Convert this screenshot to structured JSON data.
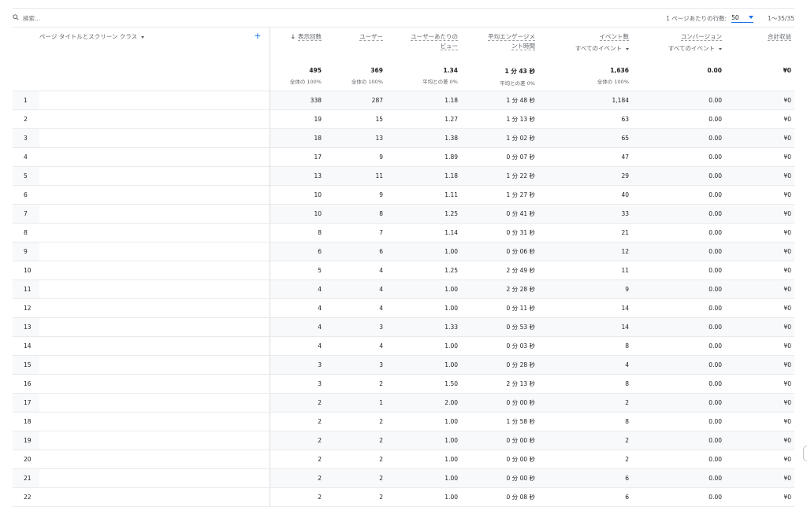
{
  "search": {
    "placeholder": "検索..."
  },
  "pagination": {
    "rows_per_page_label": "1 ページあたりの行数:",
    "rows_per_page": "50",
    "range": "1〜35/35"
  },
  "dimension_header": "ページ タイトルとスクリーン クラス",
  "columns": [
    {
      "label": "表示回数",
      "sub": ""
    },
    {
      "label": "ユーザー",
      "sub": ""
    },
    {
      "label": "ユーザーあたりの",
      "label2": "ビュー",
      "sub": ""
    },
    {
      "label": "平均エンゲージメ",
      "label2": "ント時間",
      "sub": ""
    },
    {
      "label": "イベント数",
      "sub": "すべてのイベント"
    },
    {
      "label": "コンバージョン",
      "sub": "すべてのイベント"
    },
    {
      "label": "合計収益",
      "sub": ""
    }
  ],
  "totals": {
    "views": "495",
    "views_pct": "全体の 100%",
    "users": "369",
    "users_pct": "全体の 100%",
    "vpu": "1.34",
    "vpu_diff": "平均との差 0%",
    "eng": "1 分 43 秒",
    "eng_diff": "平均との差 0%",
    "events": "1,636",
    "events_pct": "全体の 100%",
    "conv": "0.00",
    "rev": "¥0"
  },
  "rows": [
    [
      "1",
      "338",
      "287",
      "1.18",
      "1 分 48 秒",
      "1,184",
      "0.00",
      "¥0"
    ],
    [
      "2",
      "19",
      "15",
      "1.27",
      "1 分 13 秒",
      "63",
      "0.00",
      "¥0"
    ],
    [
      "3",
      "18",
      "13",
      "1.38",
      "1 分 02 秒",
      "65",
      "0.00",
      "¥0"
    ],
    [
      "4",
      "17",
      "9",
      "1.89",
      "0 分 07 秒",
      "47",
      "0.00",
      "¥0"
    ],
    [
      "5",
      "13",
      "11",
      "1.18",
      "1 分 22 秒",
      "29",
      "0.00",
      "¥0"
    ],
    [
      "6",
      "10",
      "9",
      "1.11",
      "1 分 27 秒",
      "40",
      "0.00",
      "¥0"
    ],
    [
      "7",
      "10",
      "8",
      "1.25",
      "0 分 41 秒",
      "33",
      "0.00",
      "¥0"
    ],
    [
      "8",
      "8",
      "7",
      "1.14",
      "0 分 31 秒",
      "21",
      "0.00",
      "¥0"
    ],
    [
      "9",
      "6",
      "6",
      "1.00",
      "0 分 06 秒",
      "12",
      "0.00",
      "¥0"
    ],
    [
      "10",
      "5",
      "4",
      "1.25",
      "2 分 49 秒",
      "11",
      "0.00",
      "¥0"
    ],
    [
      "11",
      "4",
      "4",
      "1.00",
      "2 分 28 秒",
      "9",
      "0.00",
      "¥0"
    ],
    [
      "12",
      "4",
      "4",
      "1.00",
      "0 分 11 秒",
      "14",
      "0.00",
      "¥0"
    ],
    [
      "13",
      "4",
      "3",
      "1.33",
      "0 分 53 秒",
      "14",
      "0.00",
      "¥0"
    ],
    [
      "14",
      "4",
      "4",
      "1.00",
      "0 分 03 秒",
      "8",
      "0.00",
      "¥0"
    ],
    [
      "15",
      "3",
      "3",
      "1.00",
      "0 分 28 秒",
      "4",
      "0.00",
      "¥0"
    ],
    [
      "16",
      "3",
      "2",
      "1.50",
      "2 分 13 秒",
      "8",
      "0.00",
      "¥0"
    ],
    [
      "17",
      "2",
      "1",
      "2.00",
      "0 分 00 秒",
      "2",
      "0.00",
      "¥0"
    ],
    [
      "18",
      "2",
      "2",
      "1.00",
      "1 分 58 秒",
      "8",
      "0.00",
      "¥0"
    ],
    [
      "19",
      "2",
      "2",
      "1.00",
      "0 分 00 秒",
      "2",
      "0.00",
      "¥0"
    ],
    [
      "20",
      "2",
      "2",
      "1.00",
      "0 分 00 秒",
      "2",
      "0.00",
      "¥0"
    ],
    [
      "21",
      "2",
      "2",
      "1.00",
      "0 分 00 秒",
      "6",
      "0.00",
      "¥0"
    ],
    [
      "22",
      "2",
      "2",
      "1.00",
      "0 分 08 秒",
      "6",
      "0.00",
      "¥0"
    ]
  ]
}
